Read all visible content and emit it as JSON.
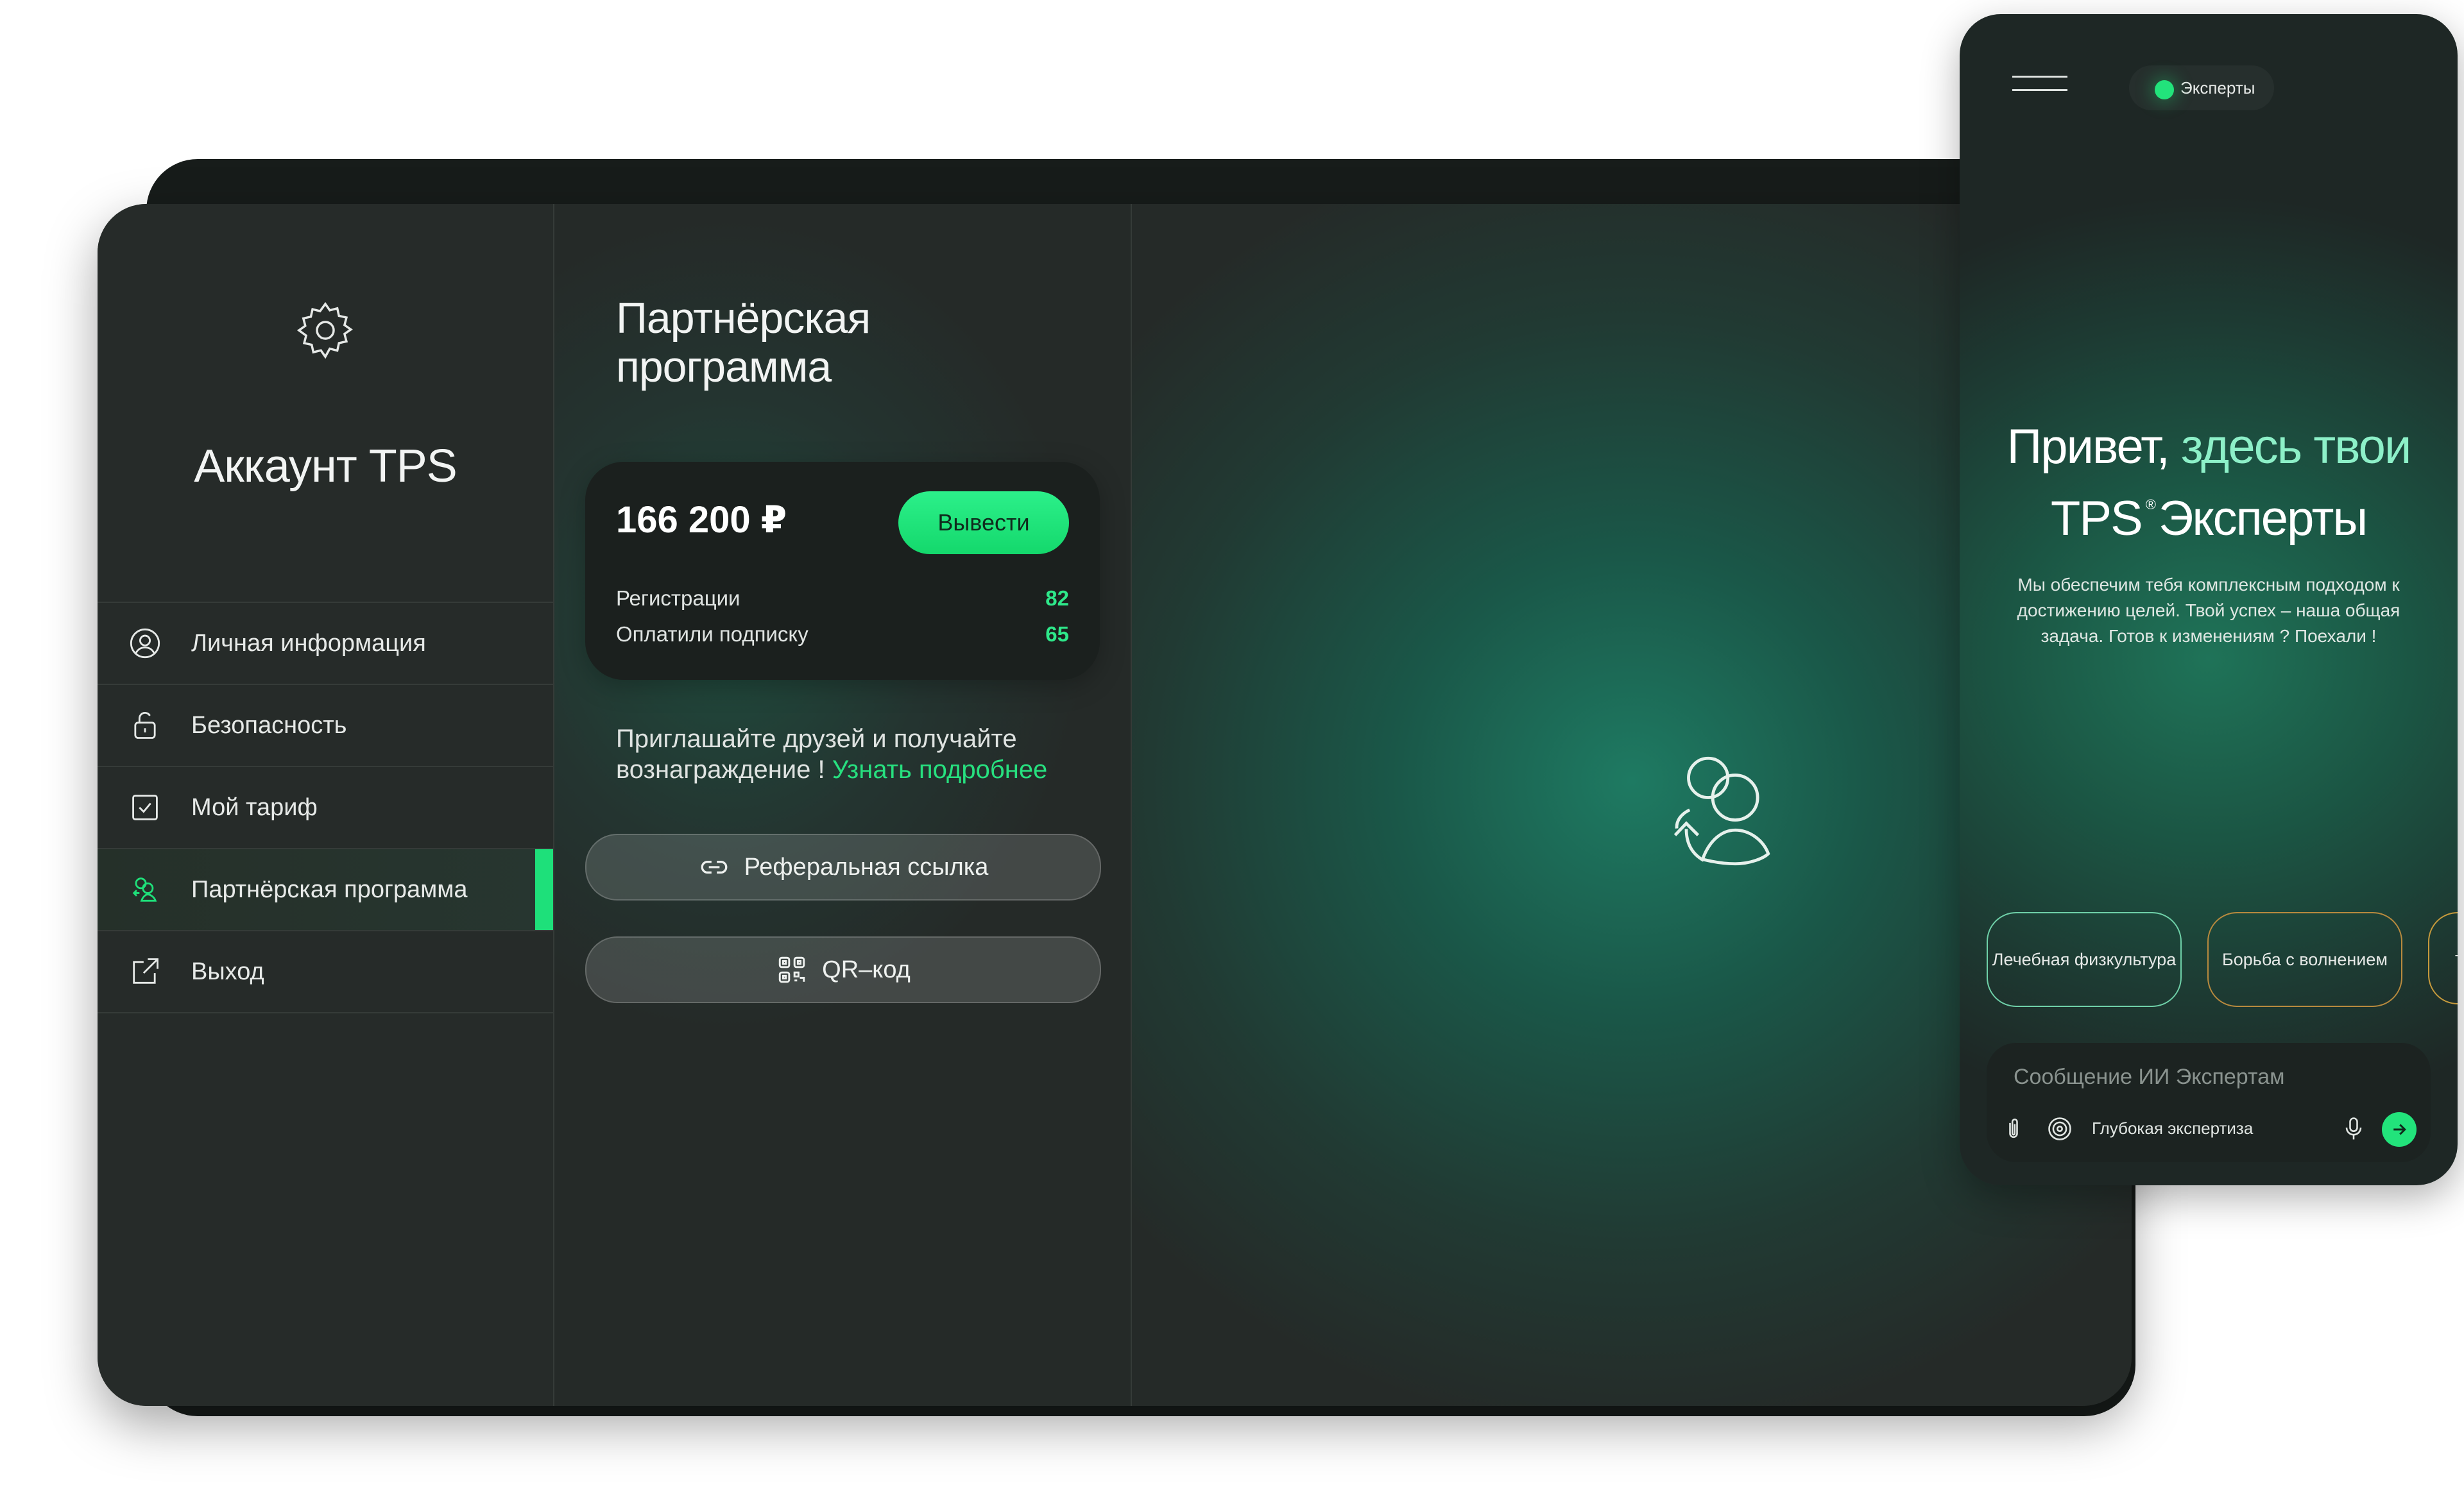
{
  "colors": {
    "accent": "#1ee07a",
    "background_dark": "#232826",
    "card": "#1b201e"
  },
  "account": {
    "title": "Аккаунт TPS",
    "menu": [
      {
        "label": "Личная информация",
        "icon": "user-circle-icon"
      },
      {
        "label": "Безопасность",
        "icon": "unlock-icon"
      },
      {
        "label": "Мой тариф",
        "icon": "checkbox-icon"
      },
      {
        "label": "Партнёрская программа",
        "icon": "partners-icon",
        "active": true
      },
      {
        "label": "Выход",
        "icon": "external-link-icon"
      }
    ]
  },
  "partner": {
    "title_line1": "Партнёрская",
    "title_line2": "программа",
    "balance": "166 200 ₽",
    "withdraw_label": "Вывести",
    "stats": [
      {
        "label": "Регистрации",
        "value": "82"
      },
      {
        "label": "Оплатили подписку",
        "value": "65"
      }
    ],
    "invite_text": "Приглашайте друзей и получайте вознаграждение ! ",
    "invite_link": "Узнать подробнее",
    "referral_button": "Реферальная ссылка",
    "qr_button": "QR–код"
  },
  "phone": {
    "experts_label": "Эксперты",
    "title_part1": "Привет, ",
    "title_part2": "здесь твои",
    "title_brand": "TPS",
    "title_reg": "®",
    "title_part3": "Эксперты",
    "description": "Мы обеспечим тебя комплексным подходом к достижению целей. Твой успех – наша общая задача. Готов к изменениям ? Поехали !",
    "tags": [
      "Лечебная физкультура",
      "Борьба с волнением",
      "тре"
    ],
    "composer_placeholder": "Сообщение ИИ Экспертам",
    "deep_expertise": "Глубокая экспертиза"
  }
}
